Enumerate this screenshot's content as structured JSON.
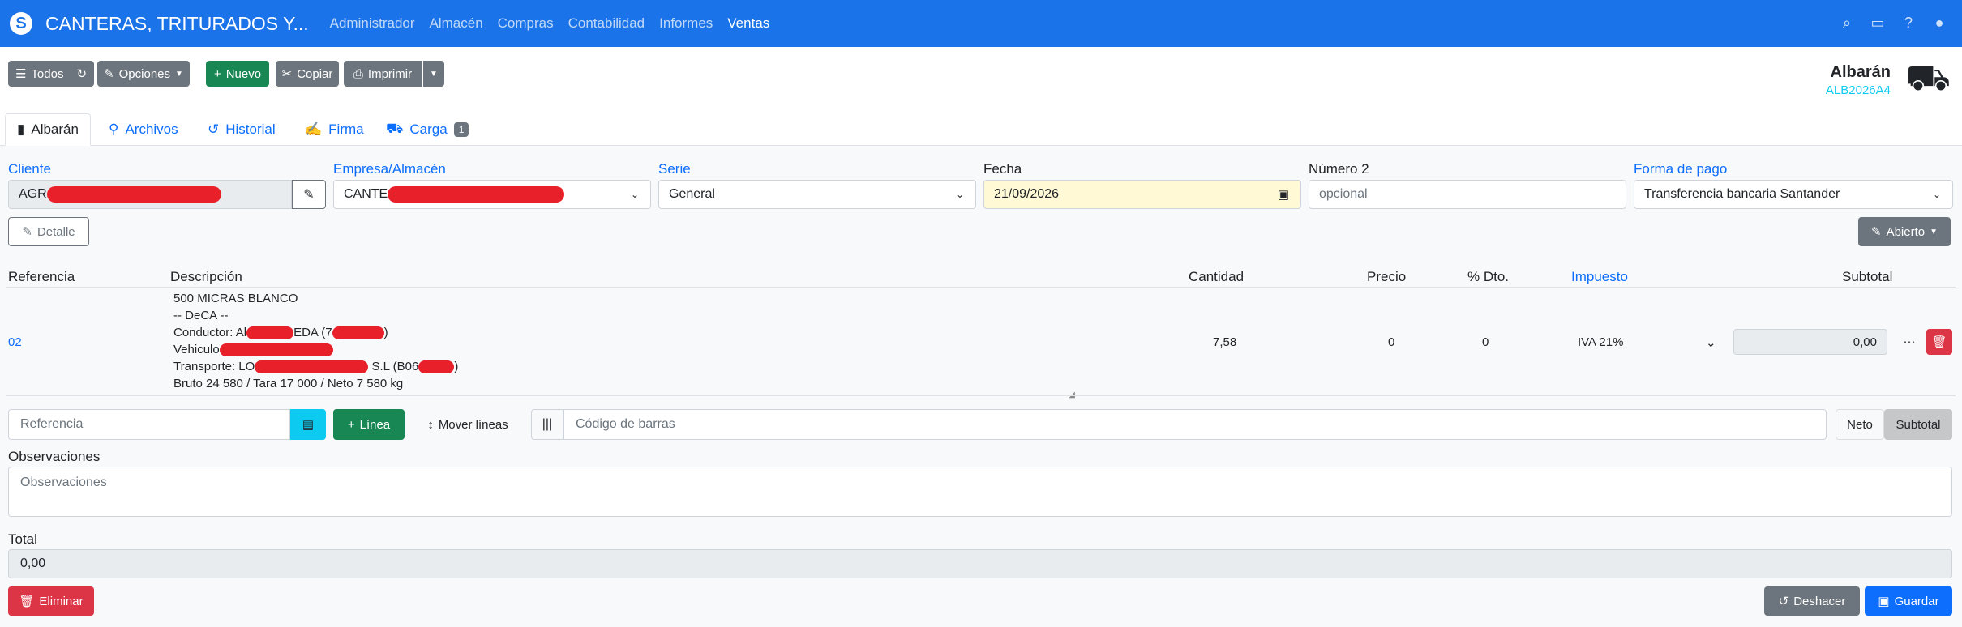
{
  "navbar": {
    "logo": "S",
    "brand": "CANTERAS, TRITURADOS Y...",
    "menu": [
      "Administrador",
      "Almacén",
      "Compras",
      "Contabilidad",
      "Informes",
      "Ventas"
    ]
  },
  "toolbar": {
    "todos": "Todos",
    "opciones": "Opciones",
    "nuevo": "Nuevo",
    "copiar": "Copiar",
    "imprimir": "Imprimir"
  },
  "header": {
    "title": "Albarán",
    "code": "ALB2026A4"
  },
  "tabs": [
    {
      "label": "Albarán"
    },
    {
      "label": "Archivos"
    },
    {
      "label": "Historial"
    },
    {
      "label": "Firma"
    },
    {
      "label": "Carga",
      "badge": "1"
    }
  ],
  "form": {
    "cliente_label": "Cliente",
    "cliente_value": "AGR",
    "empresa_label": "Empresa/Almacén",
    "empresa_value": "CANTE",
    "serie_label": "Serie",
    "serie_value": "General",
    "fecha_label": "Fecha",
    "fecha_value": "21/09/2026",
    "numero2_label": "Número 2",
    "numero2_placeholder": "opcional",
    "pago_label": "Forma de pago",
    "pago_value": "Transferencia bancaria Santander",
    "detalle": "Detalle",
    "abierto": "Abierto"
  },
  "table": {
    "headers": {
      "referencia": "Referencia",
      "descripcion": "Descripción",
      "cantidad": "Cantidad",
      "precio": "Precio",
      "dto": "% Dto.",
      "impuesto": "Impuesto",
      "subtotal": "Subtotal"
    },
    "row": {
      "referencia": "02",
      "desc_lines": [
        "500 MICRAS BLANCO",
        "-- DeCA --",
        "Conductor: Al",
        "EDA (7",
        ")",
        "Vehiculo",
        "Transporte: LO",
        "S.L (B06",
        ")",
        "Bruto 24 580 / Tara 17 000 / Neto 7 580 kg"
      ],
      "cantidad": "7,58",
      "precio": "0",
      "dto": "0",
      "impuesto": "IVA 21%",
      "subtotal": "0,00"
    }
  },
  "lines": {
    "referencia_placeholder": "Referencia",
    "linea": "Línea",
    "mover": "Mover líneas",
    "barcode_placeholder": "Código de barras",
    "neto": "Neto",
    "subtotal": "Subtotal"
  },
  "observaciones": {
    "label": "Observaciones",
    "placeholder": "Observaciones"
  },
  "total": {
    "label": "Total",
    "value": "0,00"
  },
  "footer": {
    "eliminar": "Eliminar",
    "deshacer": "Deshacer",
    "guardar": "Guardar"
  }
}
